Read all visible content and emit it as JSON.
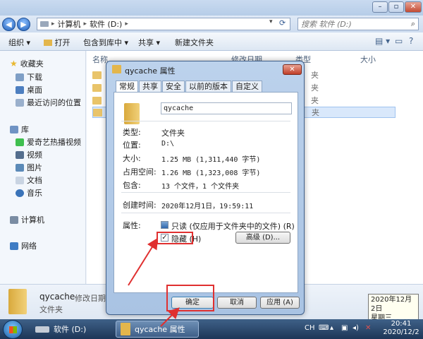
{
  "window": {
    "breadcrumb": [
      "计算机",
      "软件 (D:)"
    ],
    "search_placeholder": "搜索 软件 (D:)"
  },
  "toolbar": {
    "organize": "组织 ▾",
    "open": "打开",
    "include_in_library": "包含到库中 ▾",
    "share": "共享 ▾",
    "new_folder": "新建文件夹"
  },
  "sidebar": {
    "favorites": "收藏夹",
    "downloads": "下载",
    "desktop": "桌面",
    "recent": "最近访问的位置",
    "libraries": "库",
    "iqiyi": "爱奇艺热播视频",
    "videos": "视频",
    "pictures": "图片",
    "documents": "文档",
    "music": "音乐",
    "computer": "计算机",
    "network": "网络"
  },
  "filelist": {
    "col_name": "名称",
    "col_modified": "修改日期",
    "col_type": "类型",
    "col_size": "大小",
    "rows": [
      {
        "type": "夹"
      },
      {
        "type": "夹"
      },
      {
        "type": "夹"
      },
      {
        "type": "夹"
      }
    ]
  },
  "details_pane": {
    "name": "qycache",
    "modified_label": "修改日期: 20",
    "type": "文件夹"
  },
  "dialog": {
    "title": "qycache 属性",
    "close": "✕",
    "tabs": [
      "常规",
      "共享",
      "安全",
      "以前的版本",
      "自定义"
    ],
    "folder_name": "qycache",
    "labels": {
      "type": "类型:",
      "location": "位置:",
      "size": "大小:",
      "size_on_disk": "占用空间:",
      "contains": "包含:",
      "created": "创建时间:",
      "attributes": "属性:"
    },
    "values": {
      "type": "文件夹",
      "location": "D:\\",
      "size": "1.25 MB (1,311,440 字节)",
      "size_on_disk": "1.26 MB (1,323,008 字节)",
      "contains": "13 个文件，1 个文件夹",
      "created": "2020年12月1日，19:59:11"
    },
    "readonly_label": "只读 (仅应用于文件夹中的文件) (R)",
    "hidden_label": "隐藏 (H)",
    "hidden_checked": "✓",
    "advanced_button": "高级 (D)...",
    "ok_button": "确定",
    "cancel_button": "取消",
    "apply_button": "应用 (A)"
  },
  "taskbar": {
    "item_drive": "软件 (D:)",
    "item_properties": "qycache 属性",
    "lang": "CH",
    "time": "20:41",
    "date": "2020/12/2"
  },
  "tooltip": {
    "date": "2020年12月2日",
    "weekday": "星期三"
  },
  "colors": {
    "annotation_red": "#e03030"
  }
}
